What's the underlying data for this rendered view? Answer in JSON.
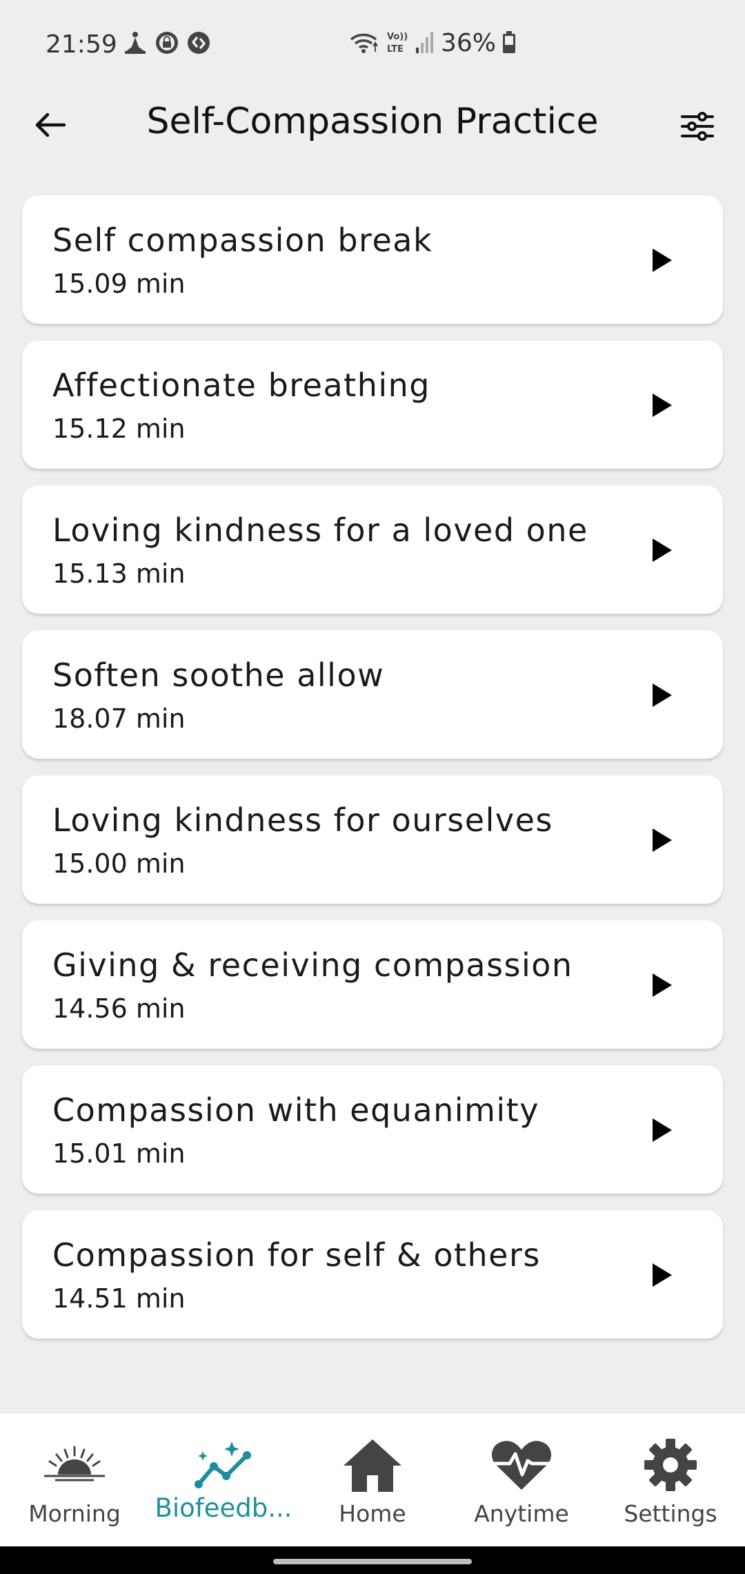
{
  "status_bar": {
    "time": "21:59",
    "battery_percent": "36%",
    "left_icons": [
      "meditation-notification-icon",
      "vpn-lock-icon",
      "shazam-icon"
    ],
    "right_icons": [
      "wifi-icon",
      "volte-icon",
      "signal-icon",
      "battery-icon"
    ],
    "volte_text": "Vo)) LTE"
  },
  "app_bar": {
    "title": "Self-Compassion Practice",
    "back_icon": "arrow-left-icon",
    "filter_icon": "sliders-icon"
  },
  "tracks": [
    {
      "title": "Self compassion break",
      "duration": "15.09 min"
    },
    {
      "title": "Affectionate breathing",
      "duration": "15.12 min"
    },
    {
      "title": "Loving kindness for a loved one",
      "duration": "15.13 min"
    },
    {
      "title": "Soften soothe allow",
      "duration": "18.07 min"
    },
    {
      "title": "Loving kindness for ourselves",
      "duration": "15.00 min"
    },
    {
      "title": "Giving & receiving compassion",
      "duration": "14.56 min"
    },
    {
      "title": "Compassion with equanimity",
      "duration": "15.01 min"
    },
    {
      "title": "Compassion for self & others",
      "duration": "14.51 min"
    }
  ],
  "bottom_nav": {
    "active": "biofeedback",
    "items": [
      {
        "id": "morning",
        "label": "Morning",
        "icon": "sunrise-icon"
      },
      {
        "id": "biofeedback",
        "label": "Biofeedb...",
        "icon": "sparkle-trend-icon"
      },
      {
        "id": "home",
        "label": "Home",
        "icon": "home-icon"
      },
      {
        "id": "anytime",
        "label": "Anytime",
        "icon": "heartbeat-icon"
      },
      {
        "id": "settings",
        "label": "Settings",
        "icon": "gear-icon"
      }
    ]
  },
  "colors": {
    "background": "#eeeeee",
    "card": "#ffffff",
    "accent": "#1e8e9e",
    "text": "#1a1a1a",
    "nav_icon": "#444444"
  }
}
